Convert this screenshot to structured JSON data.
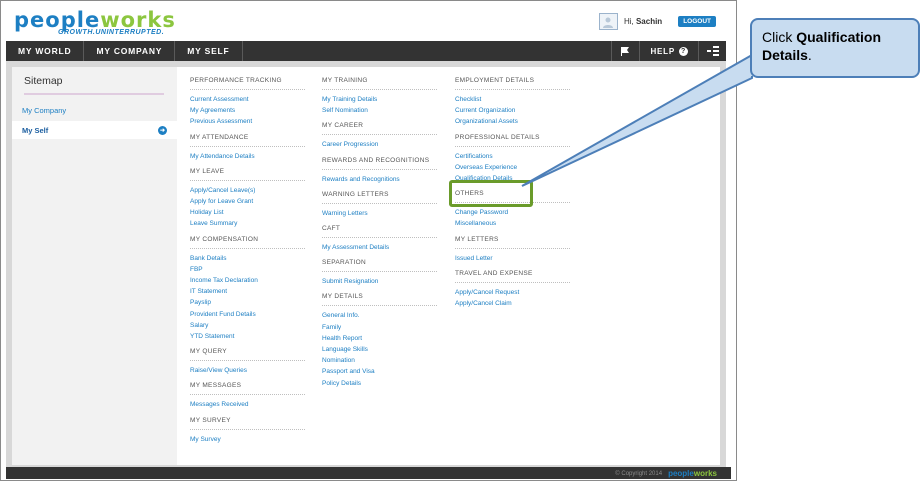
{
  "brand": {
    "logo_part1": "pe",
    "logo_part2": "ople",
    "logo_part3": "w",
    "logo_part4": "orks",
    "tagline": "GROWTH.UNINTERRUPTED.",
    "blue": "#1d7fc3",
    "green": "#8cc63f"
  },
  "header": {
    "greeting": "Hi, ",
    "user_name": "Sachin",
    "logout_label": "LOGOUT"
  },
  "nav": {
    "tabs": [
      {
        "label": "MY WORLD"
      },
      {
        "label": "MY COMPANY"
      },
      {
        "label": "MY SELF"
      }
    ],
    "help_label": "HELP",
    "flag_icon": "flag-icon",
    "menu_icon": "menu-toggle-icon"
  },
  "sidebar": {
    "title": "Sitemap",
    "items": [
      {
        "label": "My Company"
      },
      {
        "label": "My Self"
      }
    ]
  },
  "columns": [
    {
      "sections": [
        {
          "heading": "PERFORMANCE TRACKING",
          "links": [
            "Current Assessment",
            "My Agreements",
            "Previous Assessment"
          ]
        },
        {
          "heading": "MY ATTENDANCE",
          "links": [
            "My Attendance Details"
          ]
        },
        {
          "heading": "MY LEAVE",
          "links": [
            "Apply/Cancel Leave(s)",
            "Apply for Leave Grant",
            "Holiday List",
            "Leave Summary"
          ]
        },
        {
          "heading": "MY COMPENSATION",
          "links": [
            "Bank Details",
            "FBP",
            "Income Tax Declaration",
            "IT Statement",
            "Payslip",
            "Provident Fund Details",
            "Salary",
            "YTD Statement"
          ]
        },
        {
          "heading": "MY QUERY",
          "links": [
            "Raise/View Queries"
          ]
        },
        {
          "heading": "MY MESSAGES",
          "links": [
            "Messages Received"
          ]
        },
        {
          "heading": "MY SURVEY",
          "links": [
            "My Survey"
          ]
        }
      ]
    },
    {
      "sections": [
        {
          "heading": "MY TRAINING",
          "links": [
            "My Training Details",
            "Self Nomination"
          ]
        },
        {
          "heading": "MY CAREER",
          "links": [
            "Career Progression"
          ]
        },
        {
          "heading": "REWARDS AND RECOGNITIONS",
          "links": [
            "Rewards and Recognitions"
          ]
        },
        {
          "heading": "WARNING LETTERS",
          "links": [
            "Warning Letters"
          ]
        },
        {
          "heading": "CAFT",
          "links": [
            "My Assessment Details"
          ]
        },
        {
          "heading": "SEPARATION",
          "links": [
            "Submit Resignation"
          ]
        },
        {
          "heading": "MY DETAILS",
          "links": [
            "General Info.",
            "Family",
            "Health Report",
            "Language Skills",
            "Nomination",
            "Passport and Visa",
            "Policy Details"
          ]
        }
      ]
    },
    {
      "sections": [
        {
          "heading": "EMPLOYMENT DETAILS",
          "links": [
            "Checklist",
            "Current Organization",
            "Organizational Assets"
          ]
        },
        {
          "heading": "PROFESSIONAL DETAILS",
          "links": [
            "Certifications",
            "Overseas Experience",
            "Qualification Details"
          ]
        },
        {
          "heading": "OTHERS",
          "links": [
            "Change Password",
            "Miscellaneous"
          ]
        },
        {
          "heading": "MY LETTERS",
          "links": [
            "Issued Letter"
          ]
        },
        {
          "heading": "TRAVEL AND EXPENSE",
          "links": [
            "Apply/Cancel Request",
            "Apply/Cancel Claim"
          ]
        }
      ]
    }
  ],
  "footer": {
    "copyright": "© Copyright 2014"
  },
  "callout": {
    "prefix": "Click ",
    "target": "Qualification Details",
    "suffix": ".",
    "highlight_color": "#6a9b2a"
  }
}
